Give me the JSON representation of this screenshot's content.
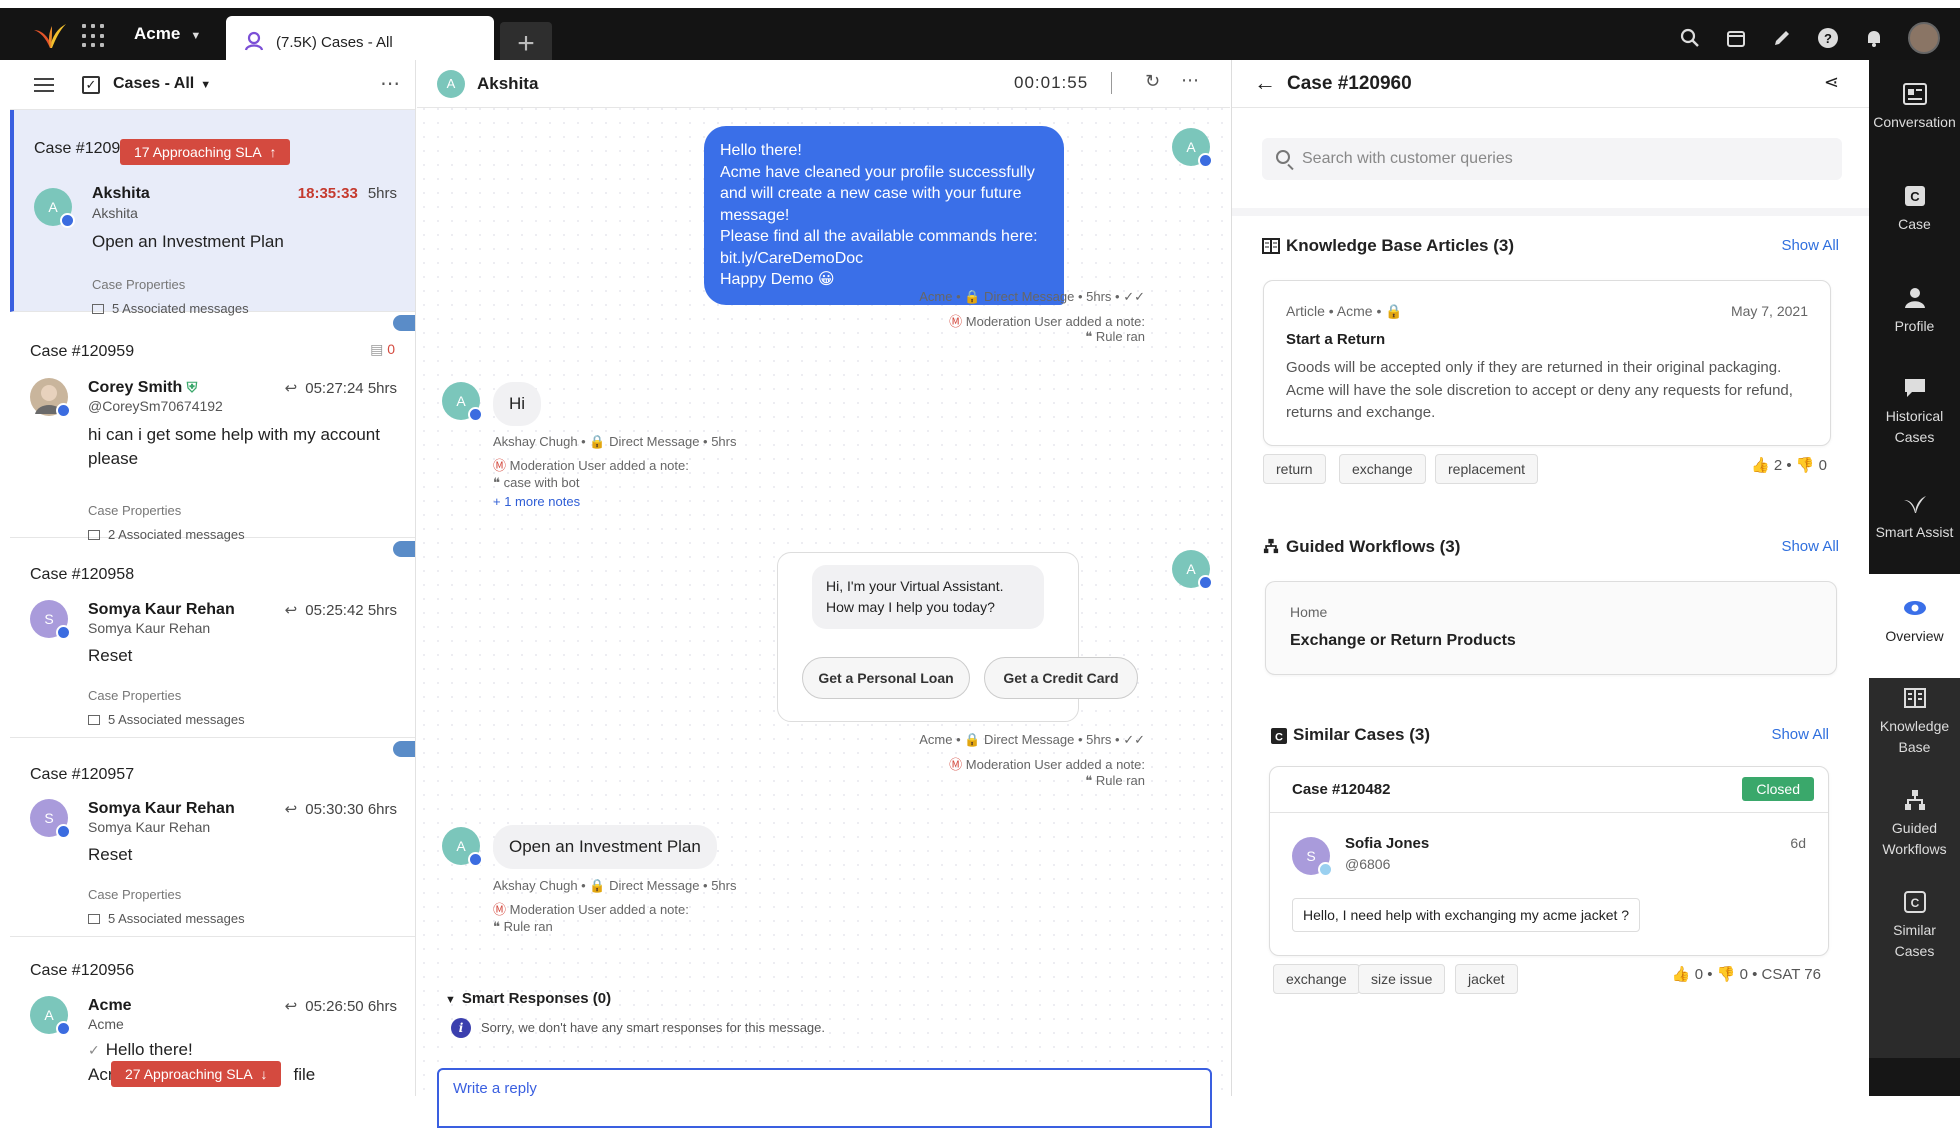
{
  "topbar": {
    "brand": "Acme",
    "tab_label": "(7.5K) Cases - All",
    "new_tab": "+"
  },
  "left": {
    "header_title": "Cases - All",
    "more": "⋯",
    "cases": [
      {
        "id": "Case #12096",
        "sla": "17 Approaching SLA",
        "sla_arrow": "↑",
        "name": "Akshita",
        "handle": "Akshita",
        "time_red": "18:35:33",
        "age": "5hrs",
        "message": "Open an Investment Plan",
        "props": "Case Properties",
        "assoc": "5 Associated messages",
        "avatar": "A",
        "avatar_color": "#7bc6bb"
      },
      {
        "id": "Case #120959",
        "comments": "0",
        "name": "Corey Smith",
        "handle": "@CoreySm70674192",
        "time": "05:27:24",
        "age": "5hrs",
        "message": "hi can i get some help with my account please",
        "props": "Case Properties",
        "assoc": "2 Associated messages",
        "avatar": "",
        "avatar_color": "#c9b59c"
      },
      {
        "id": "Case #120958",
        "name": "Somya Kaur Rehan",
        "handle": "Somya Kaur Rehan",
        "time": "05:25:42",
        "age": "5hrs",
        "message": "Reset",
        "props": "Case Properties",
        "assoc": "5 Associated messages",
        "avatar": "S",
        "avatar_color": "#a99bdb"
      },
      {
        "id": "Case #120957",
        "name": "Somya Kaur Rehan",
        "handle": "Somya Kaur Rehan",
        "time": "05:30:30",
        "age": "6hrs",
        "message": "Reset",
        "props": "Case Properties",
        "assoc": "5 Associated messages",
        "avatar": "S",
        "avatar_color": "#a99bdb"
      },
      {
        "id": "Case #120956",
        "name": "Acme",
        "handle": "Acme",
        "time": "05:26:50",
        "age": "6hrs",
        "message": "Hello there!",
        "message2_left": "Acr",
        "message2_right": "file",
        "avatar": "A",
        "avatar_color": "#7bc6bb"
      }
    ],
    "bottom_sla": "27 Approaching SLA",
    "bottom_sla_arrow": "↓"
  },
  "conversation": {
    "contact_avatar": "A",
    "contact": "Akshita",
    "timer": "00:01:55",
    "bot_message": [
      "Hello there!",
      "Acme have cleaned your profile successfully and will create a new case with your future message!",
      "Please find all the available commands here:",
      "bit.ly/CareDemoDoc",
      "Happy Demo 😀"
    ],
    "bot_meta": "Acme • 🔒 Direct Message • 5hrs • ✓✓",
    "mod_note": "Moderation User added a note:",
    "rule_ran": "Rule ran",
    "hi": "Hi",
    "user_meta": "Akshay Chugh • 🔒 Direct Message • 5hrs",
    "case_with_bot": "case with bot",
    "more_notes": "+ 1 more notes",
    "va_message": "Hi, I'm your Virtual Assistant. How may I help you today?",
    "va_btn1": "Get a Personal Loan",
    "va_btn2": "Get a Credit Card",
    "invest": "Open an Investment Plan",
    "smart_responses": "Smart Responses (0)",
    "smart_note": "Sorry, we don't have any smart responses for this message.",
    "reply_placeholder": "Write a reply"
  },
  "details": {
    "title": "Case #120960",
    "search_placeholder": "Search with customer queries",
    "kb_title": "Knowledge Base Articles (3)",
    "show_all": "Show All",
    "article_meta": "Article • Acme • 🔒",
    "article_date": "May 7, 2021",
    "article_title": "Start a Return",
    "article_body": "Goods will be accepted only if they are returned in their original packaging. Acme will have the sole discretion to accept or deny any requests for refund, returns and exchange.",
    "article_tags": [
      "return",
      "exchange",
      "replacement"
    ],
    "article_up": "2",
    "article_down": "0",
    "gw_title": "Guided Workflows (3)",
    "gw_crumb": "Home",
    "gw_name": "Exchange or Return Products",
    "sc_title": "Similar Cases (3)",
    "sc_case": "Case #120482",
    "sc_status": "Closed",
    "sc_name": "Sofia Jones",
    "sc_handle": "@6806",
    "sc_age": "6d",
    "sc_avatar": "S",
    "sc_message": "Hello, I need help with exchanging my acme jacket ?",
    "sc_tags": [
      "exchange",
      "size issue",
      "jacket"
    ],
    "sc_up": "0",
    "sc_down": "0",
    "sc_csat": "CSAT 76"
  },
  "rail": [
    "Conversation",
    "Case",
    "Profile",
    "Historical Cases",
    "Smart Assist",
    "Overview",
    "Knowledge Base",
    "Guided Workflows",
    "Similar Cases"
  ],
  "colors": {
    "accent": "#3a6fe8",
    "sla": "#d44a3f",
    "closed": "#3aa86b"
  }
}
